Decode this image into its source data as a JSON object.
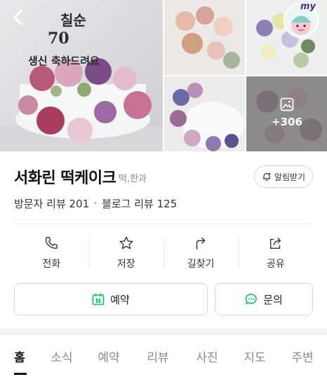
{
  "gallery": {
    "more_count": "+306",
    "cake_topper_text": [
      "칠순",
      "70",
      "생신 축하드려요"
    ],
    "profile_badge": "my"
  },
  "place": {
    "name": "서화린 떡케이크",
    "category": "떡,한과",
    "notify_label": "알림받기",
    "visitor_reviews": "방문자 리뷰 201",
    "blog_reviews": "블로그 리뷰 125"
  },
  "actions": [
    {
      "label": "전화",
      "icon": "phone-icon"
    },
    {
      "label": "저장",
      "icon": "star-icon"
    },
    {
      "label": "길찾기",
      "icon": "directions-icon"
    },
    {
      "label": "공유",
      "icon": "share-icon"
    }
  ],
  "buttons": {
    "reserve_label": "예약",
    "reserve_icon_text": "N",
    "inquiry_label": "문의"
  },
  "tabs": [
    "홈",
    "소식",
    "예약",
    "리뷰",
    "사진",
    "지도",
    "주변"
  ],
  "active_tab": "홈",
  "colors": {
    "naver_green": "#03c75a",
    "text": "#222222",
    "muted": "#8c8c8c"
  }
}
